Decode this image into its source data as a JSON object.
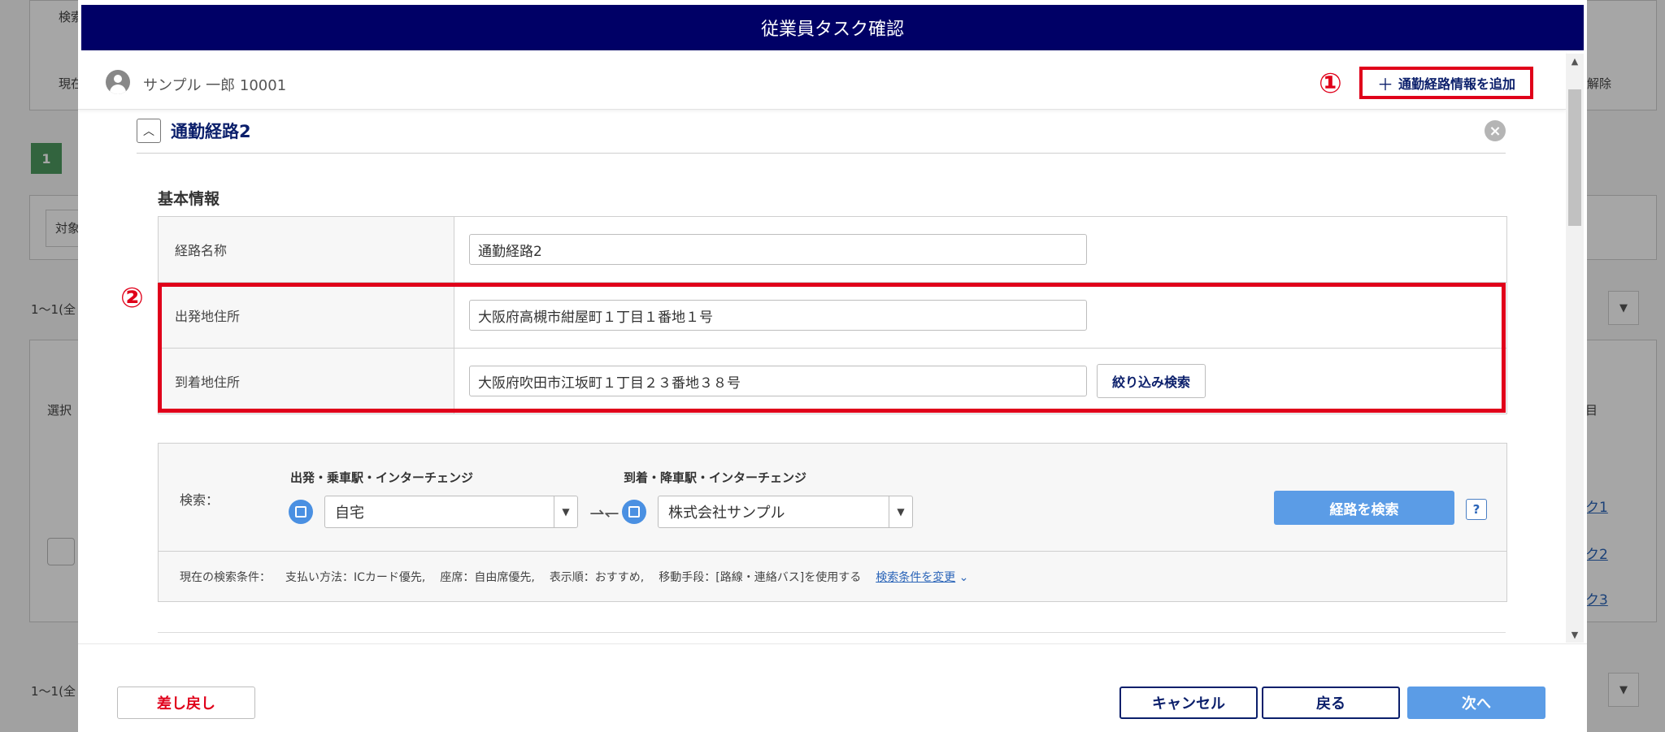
{
  "background": {
    "labels": [
      "検索",
      "現在",
      "対象",
      "1～1(全",
      "選択",
      "1～1(全"
    ],
    "step_number": "1",
    "right_labels": [
      "解除",
      "目"
    ],
    "links": [
      "ク1",
      "ク2",
      "ク3"
    ]
  },
  "modal": {
    "title": "従業員タスク確認",
    "user_name": "サンプル 一郎 10001",
    "add_route_label": "通勤経路情報を追加",
    "annotation_1": "①",
    "annotation_2": "②"
  },
  "section": {
    "title": "通勤経路2",
    "basic_info_title": "基本情報",
    "rows": [
      {
        "label": "経路名称",
        "value": "通勤経路2"
      },
      {
        "label": "出発地住所",
        "value": "大阪府高槻市紺屋町１丁目１番地１号"
      },
      {
        "label": "到着地住所",
        "value": "大阪府吹田市江坂町１丁目２３番地３８号",
        "button": "絞り込み検索"
      }
    ]
  },
  "search": {
    "label": "検索：",
    "from_caption": "出発・乗車駅・インターチェンジ",
    "from_value": "自宅",
    "to_caption": "到着・降車駅・インターチェンジ",
    "to_value": "株式会社サンプル",
    "search_button": "経路を検索",
    "help": "?",
    "conditions": {
      "prefix": "現在の検索条件：",
      "payment": "支払い方法：ICカード優先,",
      "seat": "座席：自由席優先,",
      "order": "表示順：おすすめ,",
      "transport": "移動手段：[路線・連絡バス]を使用する",
      "change_link": "検索条件を変更"
    }
  },
  "footer": {
    "return_label": "差し戻し",
    "cancel_label": "キャンセル",
    "back_label": "戻る",
    "next_label": "次へ"
  },
  "colors": {
    "header": "#000066",
    "accent_red": "#e0001a",
    "primary_blue": "#5b9ce6",
    "navy_text": "#0b1f6b"
  }
}
